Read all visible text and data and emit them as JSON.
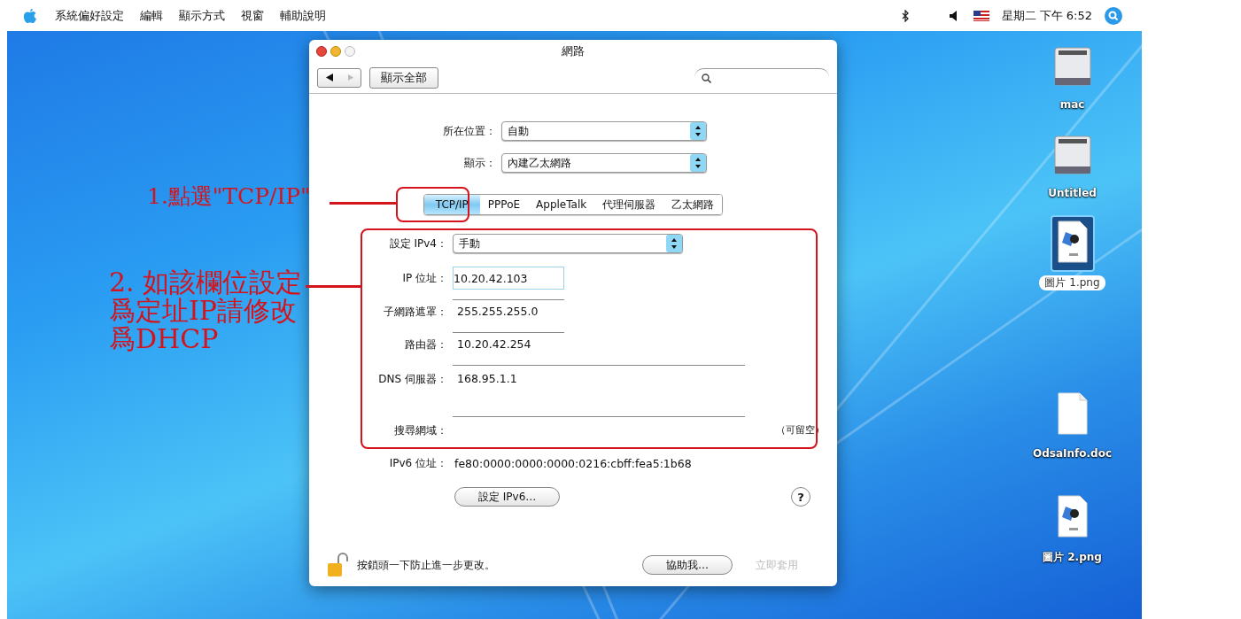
{
  "menubar": {
    "menus": [
      "系統偏好設定",
      "編輯",
      "顯示方式",
      "視窗",
      "輔助說明"
    ],
    "clock": "星期二 下午 6:52"
  },
  "window": {
    "title": "網路",
    "show_all": "顯示全部",
    "location": {
      "label": "所在位置：",
      "value": "自動"
    },
    "show": {
      "label": "顯示：",
      "value": "內建乙太網路"
    },
    "tabs": [
      {
        "label": "TCP/IP",
        "selected": true
      },
      {
        "label": "PPPoE",
        "selected": false
      },
      {
        "label": "AppleTalk",
        "selected": false
      },
      {
        "label": "代理伺服器",
        "selected": false
      },
      {
        "label": "乙太網路",
        "selected": false
      }
    ],
    "fields": [
      {
        "kind": "popup",
        "label": "設定 IPv4：",
        "value": "手動"
      },
      {
        "kind": "field",
        "label": "IP 位址：",
        "value": "10.20.42.103"
      },
      {
        "kind": "inset",
        "label": "子網路遮罩：",
        "value": "255.255.255.0"
      },
      {
        "kind": "inset",
        "label": "路由器：",
        "value": "10.20.42.254"
      },
      {
        "kind": "area",
        "label": "DNS 伺服器：",
        "value": "168.95.1.1"
      },
      {
        "kind": "domain",
        "label": "搜尋網域：",
        "hint": "（可留空）"
      }
    ],
    "ipv6": {
      "label": "IPv6 位址：",
      "value": "fe80:0000:0000:0000:0216:cbff:fea5:1b68"
    },
    "ipv6_button": "設定 IPv6…",
    "help_glyph": "?",
    "lock_text": "按鎖頭一下防止進一步更改。",
    "help_button": "協助我…",
    "apply_button": {
      "label": "立即套用",
      "disabled": true
    }
  },
  "desktop_icons": [
    {
      "kind": "drive",
      "label": "mac",
      "selected": false
    },
    {
      "kind": "drive",
      "label": "Untitled",
      "selected": false
    },
    {
      "kind": "png",
      "label": "圖片 1.png",
      "selected": true
    },
    {
      "kind": "doc",
      "label": "OdsaInfo.doc",
      "selected": false
    },
    {
      "kind": "png",
      "label": "圖片 2.png",
      "selected": false
    }
  ],
  "annotations": [
    {
      "text": "1.點選\"TCP/IP\""
    },
    {
      "lines": [
        "2. 如該欄位設定",
        "爲定址IP請修改",
        "爲DHCP"
      ]
    }
  ]
}
